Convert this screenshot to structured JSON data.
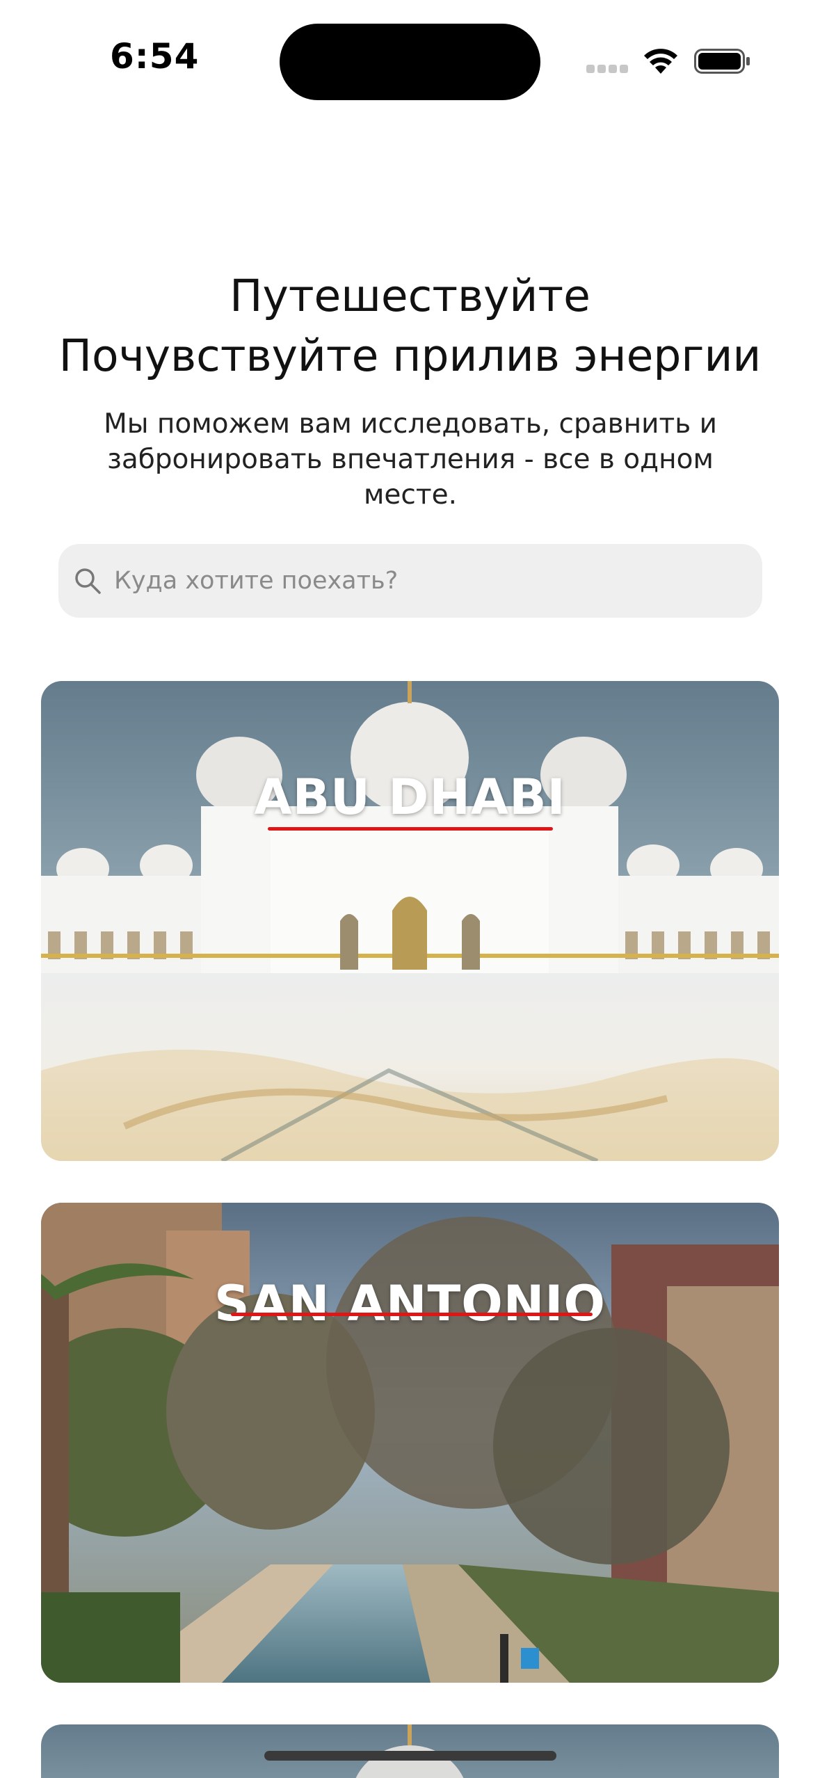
{
  "status_bar": {
    "time": "6:54"
  },
  "hero": {
    "title_line1": "Путешествуйте",
    "title_line2": "Почувствуйте прилив энергии",
    "subtitle": "Мы поможем вам исследовать, сравнить и забронировать впечатления - все в одном месте."
  },
  "search": {
    "placeholder": "Куда хотите поехать?",
    "value": ""
  },
  "destinations": [
    {
      "name": "ABU DHABI"
    },
    {
      "name": "SAN ANTONIO"
    }
  ],
  "colors": {
    "underline": "#e01515",
    "search_bg": "#efefef",
    "text": "#111111"
  },
  "icons": [
    "signal-icon",
    "wifi-icon",
    "battery-icon",
    "search-icon"
  ]
}
